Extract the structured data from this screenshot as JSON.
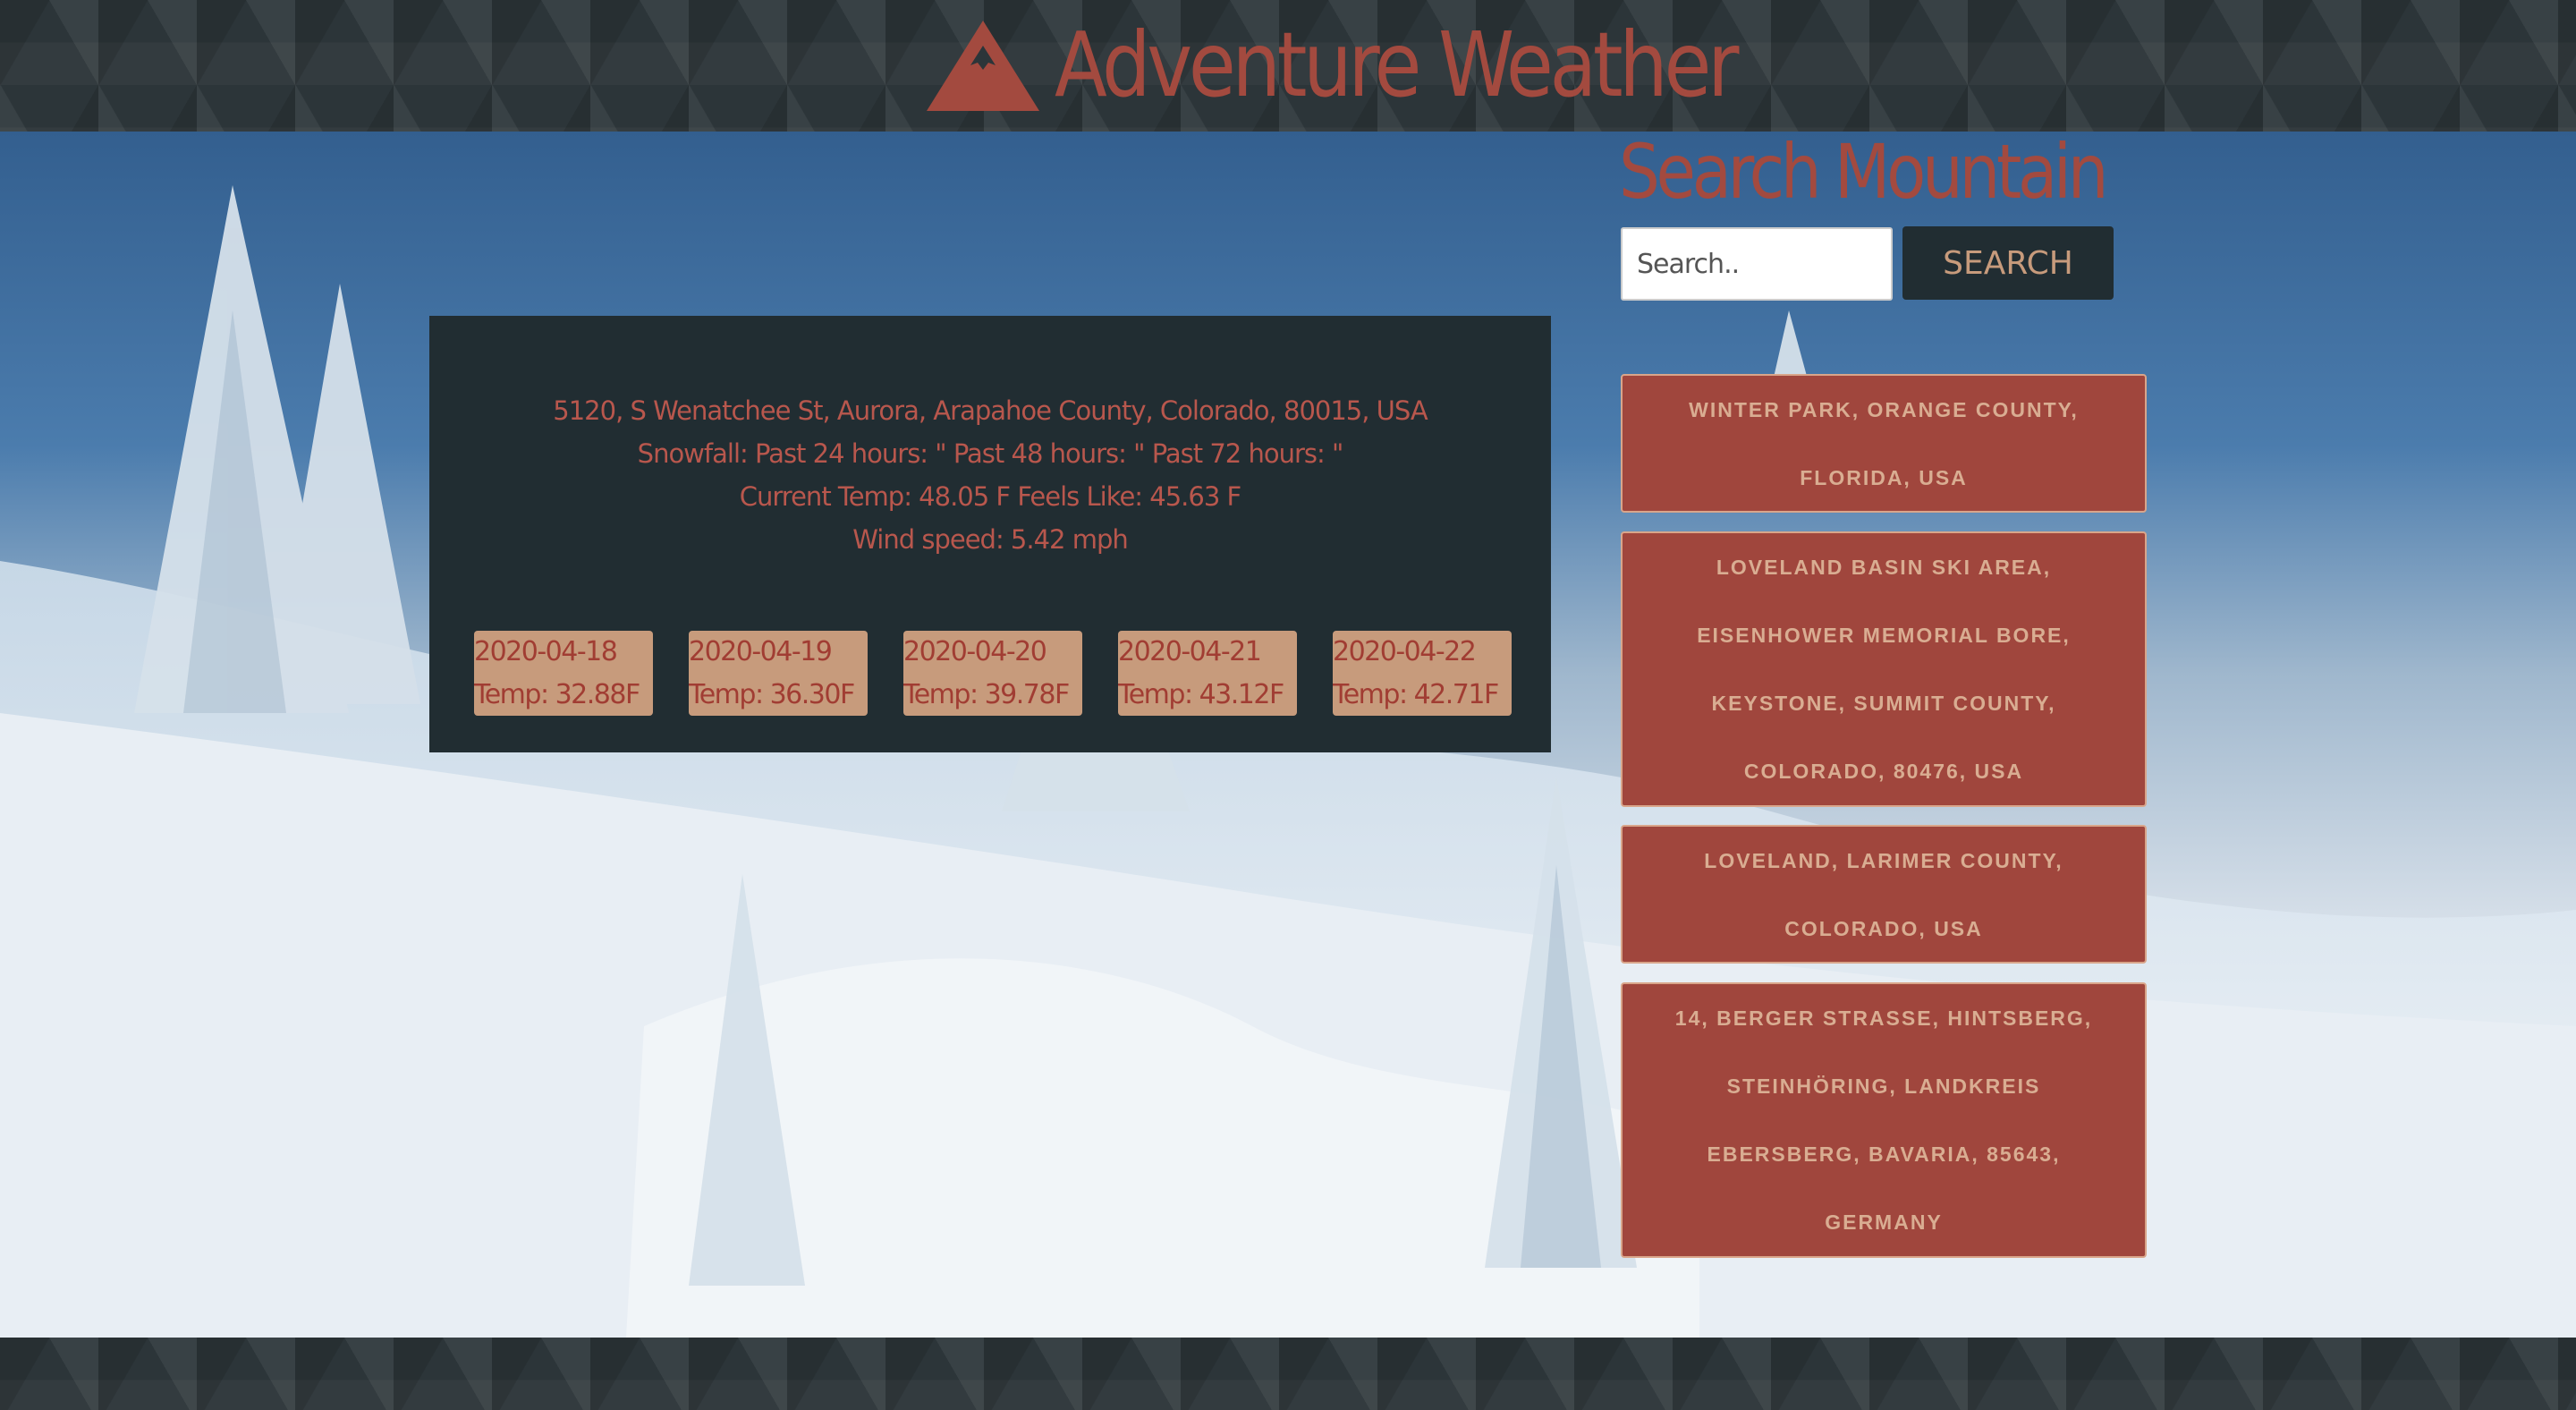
{
  "brand": {
    "title": "Adventure Weather",
    "icon": "mountain-icon"
  },
  "weather": {
    "address": "5120, S Wenatchee St, Aurora, Arapahoe County, Colorado, 80015, USA",
    "snowfall": "Snowfall: Past 24 hours: \" Past 48 hours: \" Past 72 hours: \"",
    "current": "Current Temp: 48.05 F Feels Like: 45.63 F",
    "wind": "Wind speed: 5.42 mph"
  },
  "forecast": [
    {
      "date": "2020-04-18",
      "temp": "Temp: 32.88F"
    },
    {
      "date": "2020-04-19",
      "temp": "Temp: 36.30F"
    },
    {
      "date": "2020-04-20",
      "temp": "Temp: 39.78F"
    },
    {
      "date": "2020-04-21",
      "temp": "Temp: 43.12F"
    },
    {
      "date": "2020-04-22",
      "temp": "Temp: 42.71F"
    }
  ],
  "search": {
    "title": "Search Mountain",
    "placeholder": "Search..",
    "value": "",
    "button_label": "SEARCH"
  },
  "results": [
    {
      "lines": [
        "WINTER PARK, ORANGE COUNTY,",
        "FLORIDA, USA"
      ]
    },
    {
      "lines": [
        "LOVELAND BASIN SKI AREA,",
        "EISENHOWER MEMORIAL BORE,",
        "KEYSTONE, SUMMIT COUNTY,",
        "COLORADO, 80476, USA"
      ]
    },
    {
      "lines": [
        "LOVELAND, LARIMER COUNTY,",
        "COLORADO, USA"
      ]
    },
    {
      "lines": [
        "14, BERGER STRASSE, HINTSBERG,",
        "STEINHÖRING, LANDKREIS",
        "EBERSBERG, BAVARIA, 85643,",
        "GERMANY"
      ]
    }
  ],
  "colors": {
    "accent": "#a34a3f",
    "panel": "#212d32",
    "card": "#c79b7c",
    "result": "#a0463d"
  }
}
